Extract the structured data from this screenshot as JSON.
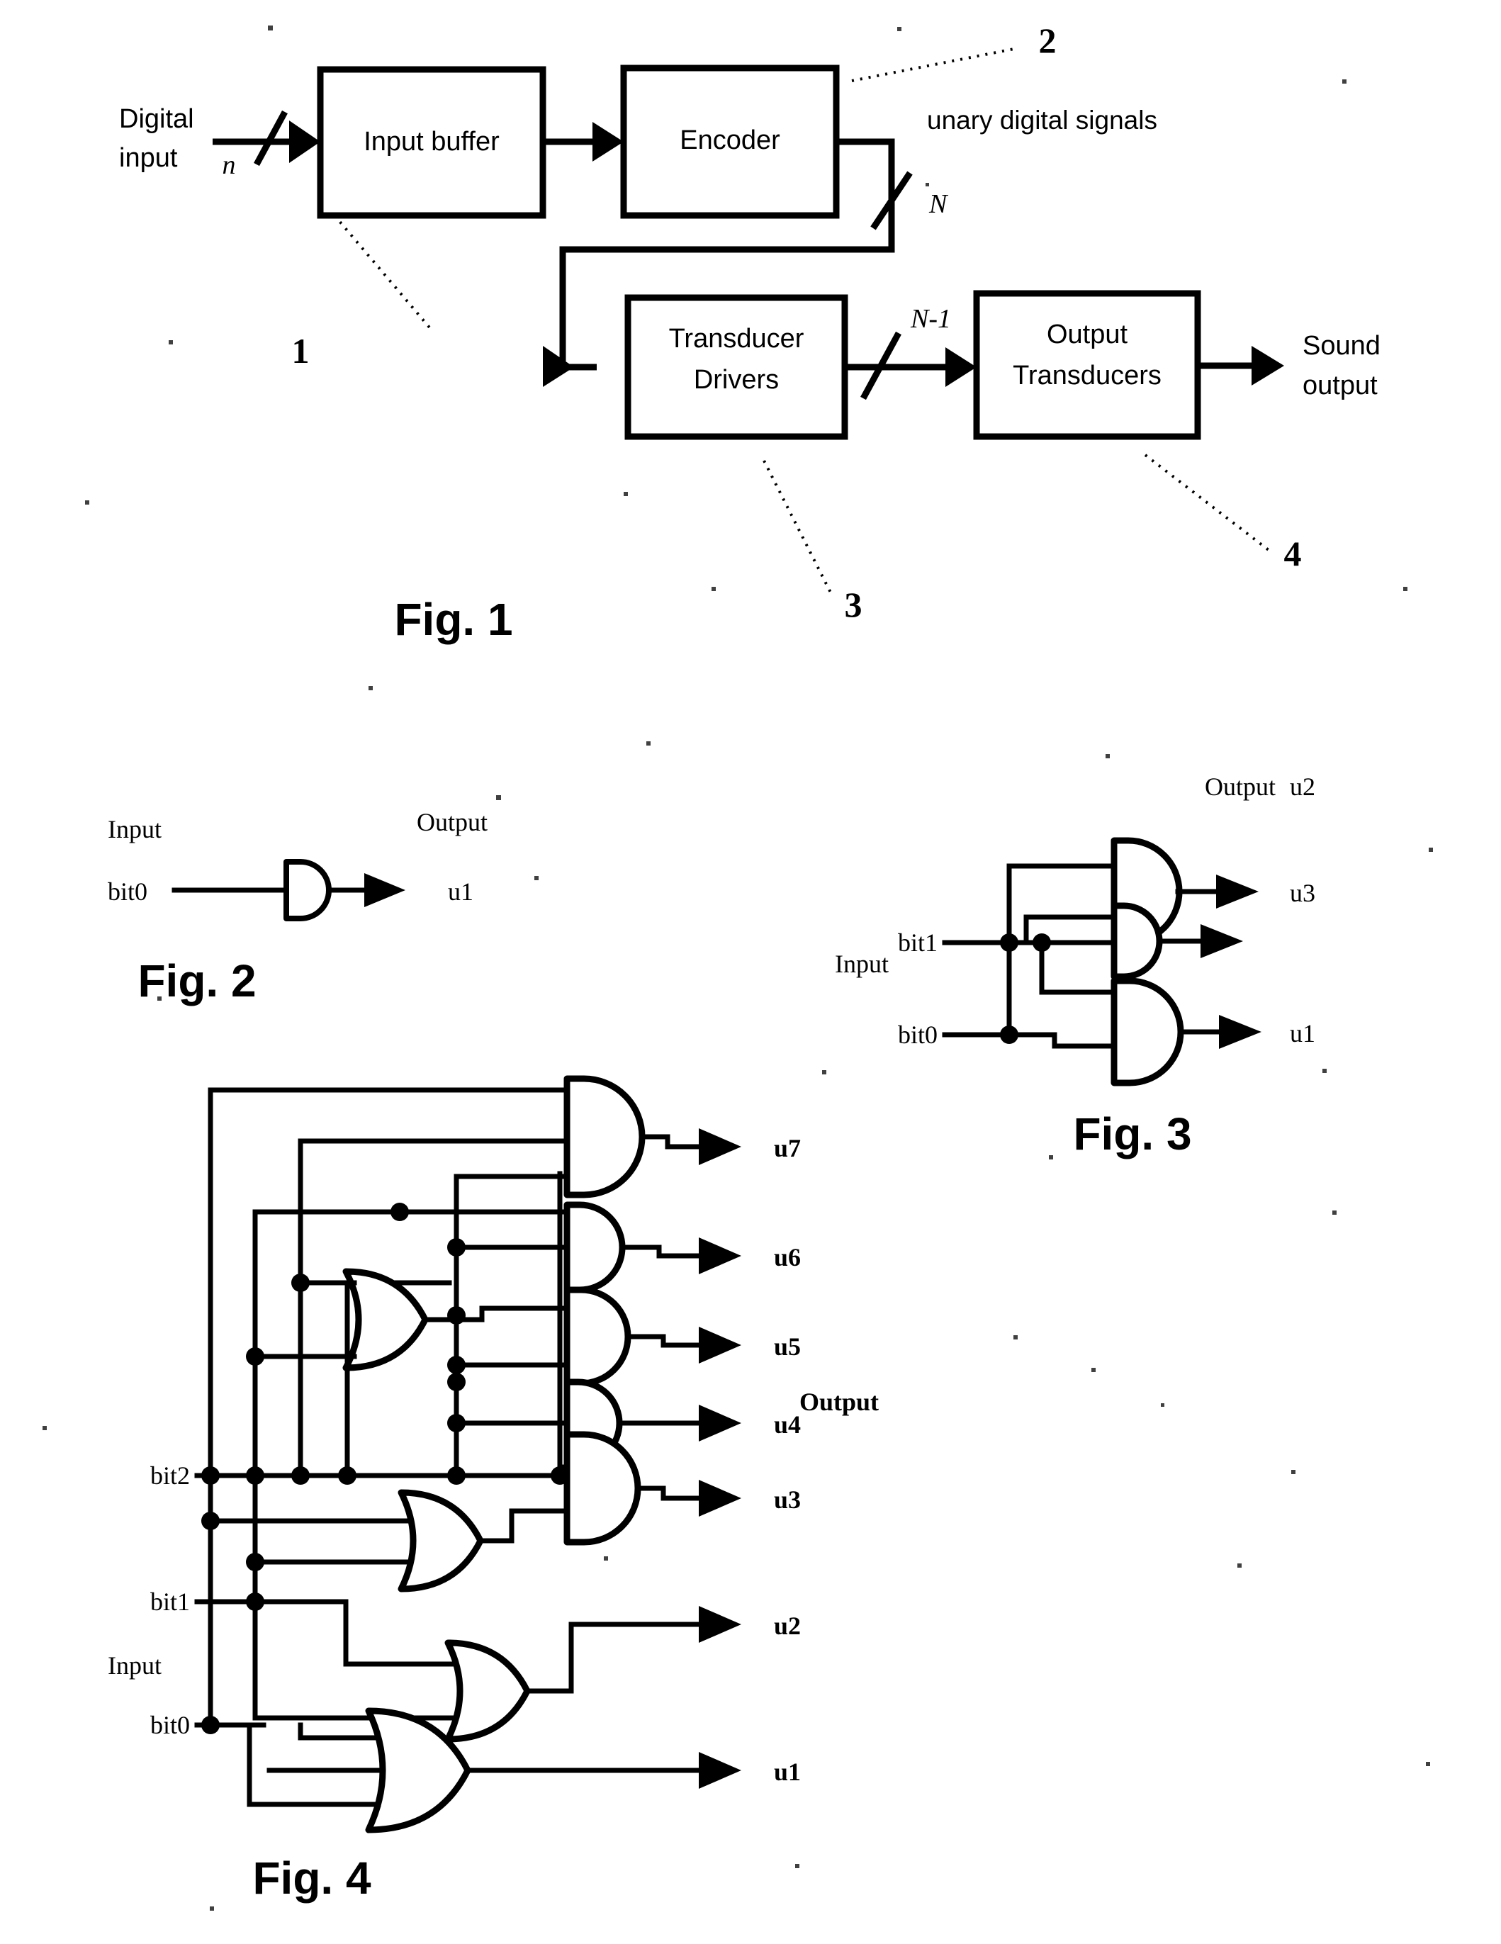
{
  "document": {
    "type": "patent-drawing-sheet",
    "background_color": "#ffffff",
    "ink_color": "#000000"
  },
  "figure1": {
    "caption": "Fig. 1",
    "blocks": [
      {
        "id": "input-buffer",
        "label": "Input buffer",
        "ref": "1"
      },
      {
        "id": "encoder",
        "label": "Encoder",
        "ref": "2"
      },
      {
        "id": "transducer-drivers",
        "label_line1": "Transducer",
        "label_line2": "Drivers",
        "ref": "3"
      },
      {
        "id": "output-transducers",
        "label_line1": "Output",
        "label_line2": "Transducers",
        "ref": "4"
      }
    ],
    "signals": {
      "digital_input_line1": "Digital",
      "digital_input_line2": "input",
      "digital_input_bus": "n",
      "unary_signals": "unary digital signals",
      "encoder_bus": "N",
      "driver_bus": "N-1",
      "sound_output_line1": "Sound",
      "sound_output_line2": "output"
    },
    "reference_numbers": [
      "1",
      "2",
      "3",
      "4"
    ]
  },
  "figure2": {
    "caption": "Fig. 2",
    "input_heading": "Input",
    "output_heading": "Output",
    "inputs": [
      "bit0"
    ],
    "outputs": [
      "u1"
    ],
    "gates": [
      {
        "id": "g-u1",
        "type": "AND",
        "inputs": [
          "bit0"
        ],
        "output": "u1"
      }
    ]
  },
  "figure3": {
    "caption": "Fig. 3",
    "input_heading": "Input",
    "output_heading": "Output",
    "inputs": [
      "bit1",
      "bit0"
    ],
    "outputs": [
      "u3",
      "u2",
      "u1"
    ],
    "gates": [
      {
        "id": "g-u3",
        "type": "AND",
        "inputs": [
          "bit1",
          "bit0"
        ],
        "output": "u3"
      },
      {
        "id": "g-u2",
        "type": "AND",
        "inputs": [
          "bit1"
        ],
        "output": "u2"
      },
      {
        "id": "g-u1",
        "type": "AND",
        "inputs": [
          "bit1",
          "bit0"
        ],
        "output": "u1"
      }
    ]
  },
  "figure4": {
    "caption": "Fig. 4",
    "input_heading": "Input",
    "output_heading": "Output",
    "inputs": [
      "bit2",
      "bit1",
      "bit0"
    ],
    "outputs": [
      "u7",
      "u6",
      "u5",
      "u4",
      "u3",
      "u2",
      "u1"
    ],
    "gates": [
      {
        "id": "g-u7",
        "type": "AND",
        "inputs": [
          "bit2",
          "bit1",
          "bit0"
        ],
        "output": "u7"
      },
      {
        "id": "g-u6",
        "type": "AND",
        "inputs": [
          "bit2",
          "bit1"
        ],
        "output": "u6"
      },
      {
        "id": "g-u5",
        "type": "AND",
        "inputs": [
          "or-a",
          "bit2"
        ],
        "output": "u5"
      },
      {
        "id": "g-u4",
        "type": "AND",
        "inputs": [
          "bit2"
        ],
        "output": "u4"
      },
      {
        "id": "g-u3",
        "type": "AND",
        "inputs": [
          "bit2",
          "or-b"
        ],
        "output": "u3"
      },
      {
        "id": "g-or-a",
        "type": "OR",
        "inputs": [
          "bit2",
          "bit1"
        ],
        "output": "or-a"
      },
      {
        "id": "g-or-b",
        "type": "OR",
        "inputs": [
          "bit1",
          "bit0"
        ],
        "output": "or-b"
      },
      {
        "id": "g-u2",
        "type": "OR",
        "inputs": [
          "bit1",
          "bit0"
        ],
        "output": "u2"
      },
      {
        "id": "g-u1",
        "type": "OR",
        "inputs": [
          "bit2",
          "bit1",
          "bit0"
        ],
        "output": "u1"
      }
    ]
  }
}
